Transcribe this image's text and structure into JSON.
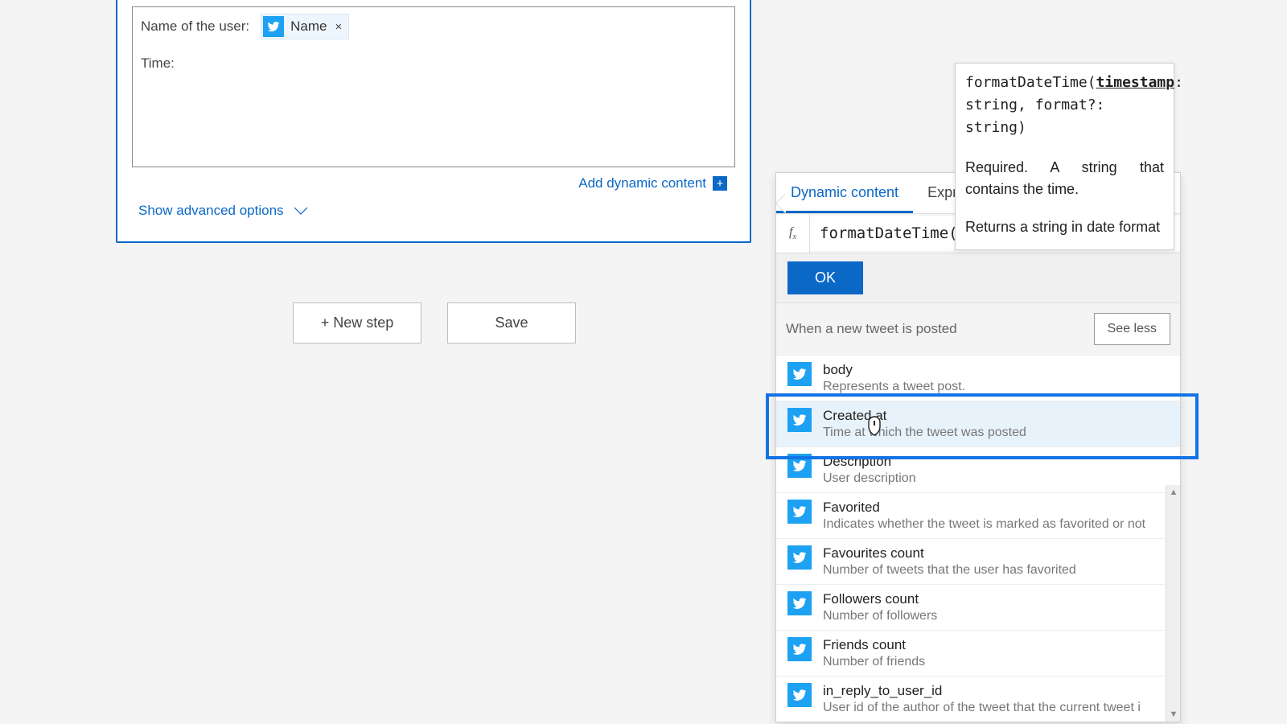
{
  "step": {
    "label_user": "Name of the user:",
    "token_name": "Name",
    "token_close": "×",
    "label_time": "Time:",
    "add_dynamic": "Add dynamic content",
    "advanced": "Show advanced options"
  },
  "buttons": {
    "new_step": "+ New step",
    "save": "Save"
  },
  "popover": {
    "tab_dc": "Dynamic content",
    "tab_ex": "Expression",
    "fx": "fx",
    "formula": "formatDateTime(",
    "ok": "OK",
    "section": "When a new tweet is posted",
    "see_less": "See less",
    "items": [
      {
        "t": "body",
        "d": "Represents a tweet post."
      },
      {
        "t": "Created at",
        "d": "Time at which the tweet was posted"
      },
      {
        "t": "Description",
        "d": "User description"
      },
      {
        "t": "Favorited",
        "d": "Indicates whether the tweet is marked as favorited or not"
      },
      {
        "t": "Favourites count",
        "d": "Number of tweets that the user has favorited"
      },
      {
        "t": "Followers count",
        "d": "Number of followers"
      },
      {
        "t": "Friends count",
        "d": "Number of friends"
      },
      {
        "t": "in_reply_to_user_id",
        "d": "User id of the author of the tweet that the current tweet i"
      }
    ]
  },
  "tooltip": {
    "sig_pre": "formatDateTime(",
    "sig_arg": "timestamp",
    "sig_post": ": string, format?: string)",
    "req": "Required. A string that contains the time.",
    "ret": "Returns a string in date format"
  }
}
